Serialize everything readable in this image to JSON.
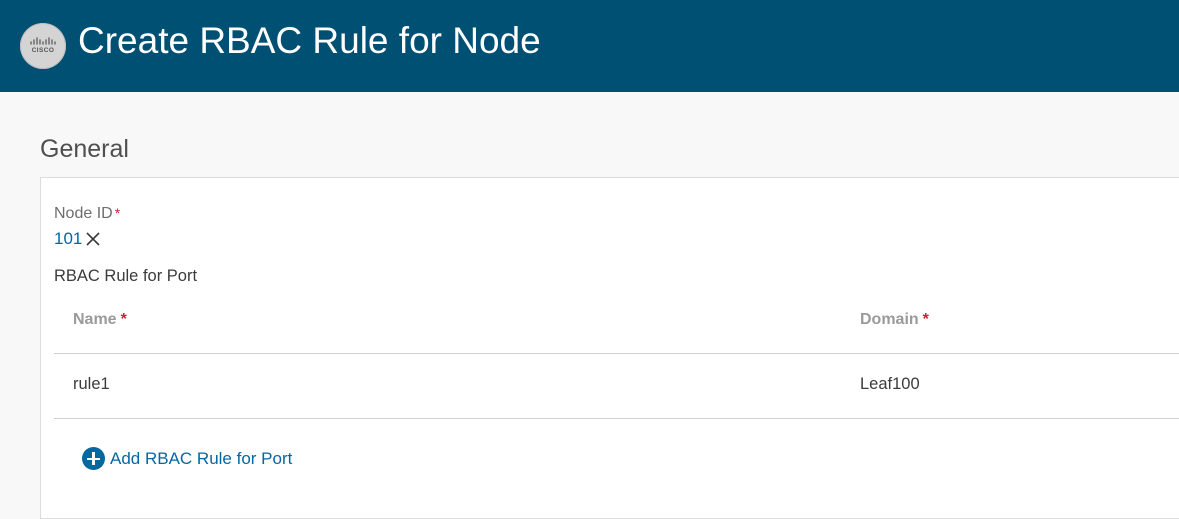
{
  "header": {
    "logo_text": "CISCO",
    "title": "Create RBAC Rule for Node"
  },
  "general": {
    "section_title": "General",
    "node_id": {
      "label": "Node ID",
      "required_mark": "*",
      "value": "101"
    },
    "rbac_port": {
      "label": "RBAC Rule for Port",
      "columns": [
        {
          "label": "Name",
          "required_mark": "*"
        },
        {
          "label": "Domain",
          "required_mark": "*"
        }
      ],
      "rows": [
        {
          "name": "rule1",
          "domain": "Leaf100"
        }
      ],
      "add_label": "Add RBAC Rule for Port"
    }
  },
  "colors": {
    "header_bg": "#005073",
    "link": "#04679f",
    "required": "#cf2030"
  },
  "icons": {
    "logo": "cisco-logo-icon",
    "remove": "close-icon",
    "add": "plus-circle-icon"
  }
}
